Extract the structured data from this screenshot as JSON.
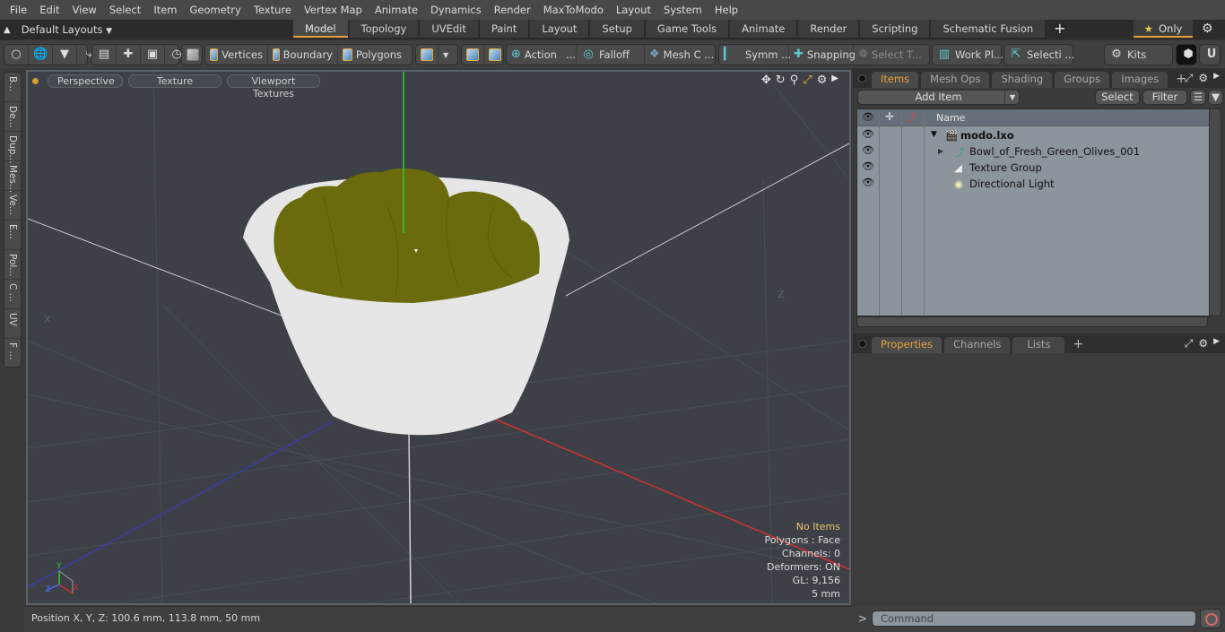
{
  "menu": [
    "File",
    "Edit",
    "View",
    "Select",
    "Item",
    "Geometry",
    "Texture",
    "Vertex Map",
    "Animate",
    "Dynamics",
    "Render",
    "MaxToModo",
    "Layout",
    "System",
    "Help"
  ],
  "layoutbar": {
    "layouts_label": "Default Layouts",
    "tabs": [
      "Model",
      "Topology",
      "UVEdit",
      "Paint",
      "Layout",
      "Setup",
      "Game Tools",
      "Animate",
      "Render",
      "Scripting",
      "Schematic Fusion"
    ],
    "active_tab": "Model",
    "only_label": "Only"
  },
  "toolbar": {
    "vertices": "Vertices",
    "boundary": "Boundary",
    "polygons": "Polygons",
    "action": "Action",
    "falloff": "Falloff",
    "mesh_constraints": "Mesh C ...",
    "symmetry": "Symm ...",
    "snapping": "Snapping",
    "select_through": "Select T...",
    "work_plane": "Work Pl...",
    "selection_sets": "Selecti ...",
    "kits": "Kits"
  },
  "left_tabs": [
    "B...",
    "De...",
    "Dup...",
    "Mes...",
    "Ve...",
    "E...",
    "Pol...",
    "C ...",
    "UV",
    "F ..."
  ],
  "viewport": {
    "view_mode": "Perspective",
    "shading": "Texture",
    "textures": "Viewport Textures",
    "stats": {
      "selection": "No Items",
      "polygons": "Polygons : Face",
      "channels": "Channels: 0",
      "deformers": "Deformers: ON",
      "gl": "GL: 9,156",
      "grid": "5 mm"
    },
    "axis_labels": {
      "x": "X",
      "y": "Y",
      "z": "Z"
    }
  },
  "statusbar": {
    "position": "Position X, Y, Z:   100.6 mm, 113.8 mm, 50 mm"
  },
  "items_panel": {
    "tabs": [
      "Items",
      "Mesh Ops",
      "Shading",
      "Groups",
      "Images"
    ],
    "active_tab": "Items",
    "add_item": "Add Item",
    "select": "Select",
    "filter": "Filter",
    "column_name": "Name",
    "tree": [
      {
        "label": "modo.lxo",
        "level": 0,
        "icon": "scene-icon",
        "bold": true
      },
      {
        "label": "Bowl_of_Fresh_Green_Olives_001",
        "level": 1,
        "icon": "mesh-locator-icon"
      },
      {
        "label": "Texture Group",
        "level": 1,
        "icon": "texture-group-icon"
      },
      {
        "label": "Directional Light",
        "level": 1,
        "icon": "light-icon"
      }
    ]
  },
  "properties_panel": {
    "tabs": [
      "Properties",
      "Channels",
      "Lists"
    ],
    "active_tab": "Properties"
  },
  "command": {
    "prompt": ">",
    "placeholder": "Command"
  },
  "colors": {
    "accent": "#e39d3a",
    "bowl": "#e6e6e6",
    "olives": "#6b6a0c",
    "viewport_bg": "#3d4147"
  }
}
